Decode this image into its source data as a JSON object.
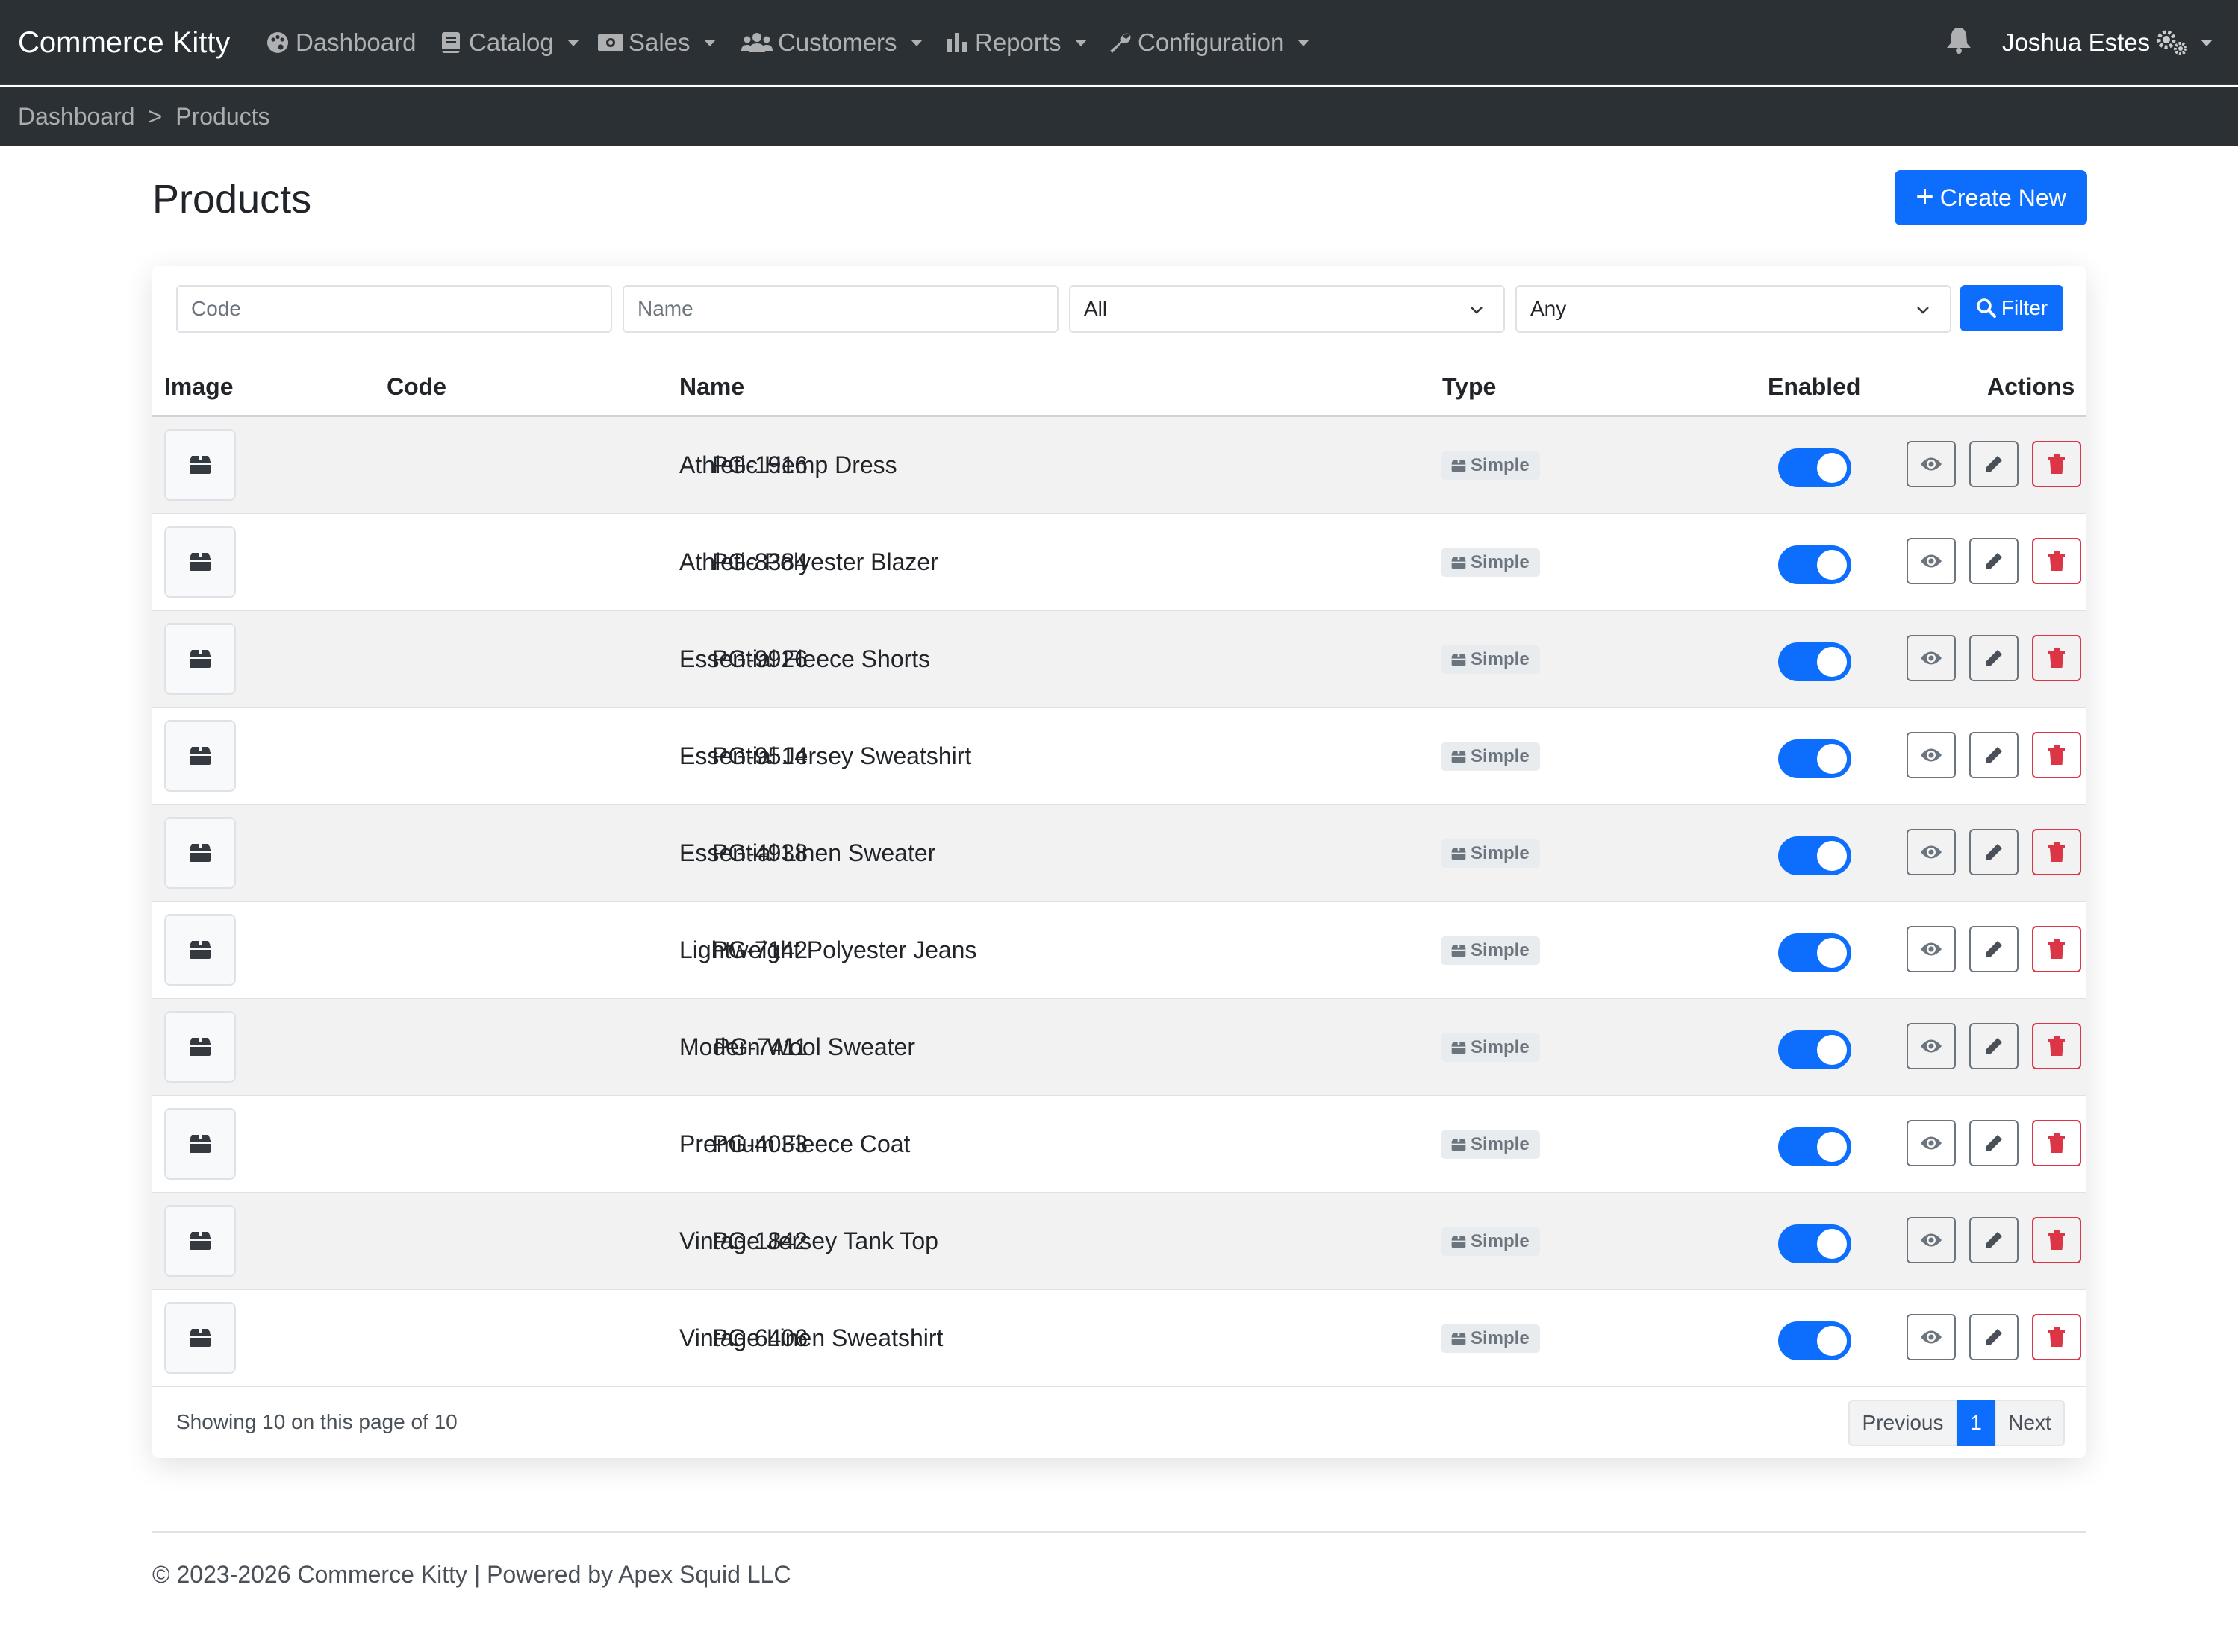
{
  "app": {
    "brand": "Commerce Kitty"
  },
  "nav": {
    "items": [
      {
        "label": "Dashboard",
        "icon": "palette-icon",
        "dropdown": false
      },
      {
        "label": "Catalog",
        "icon": "book-icon",
        "dropdown": true
      },
      {
        "label": "Sales",
        "icon": "money-bill-icon",
        "dropdown": true
      },
      {
        "label": "Customers",
        "icon": "users-icon",
        "dropdown": true
      },
      {
        "label": "Reports",
        "icon": "chart-bar-icon",
        "dropdown": true
      },
      {
        "label": "Configuration",
        "icon": "wrench-icon",
        "dropdown": true
      }
    ],
    "notifications_icon": "bell-icon",
    "user": {
      "name": "Joshua Estes",
      "icon": "gears-icon"
    }
  },
  "breadcrumb": {
    "items": [
      "Dashboard",
      "Products"
    ],
    "separator": ">"
  },
  "page": {
    "title": "Products",
    "create_label": "Create New"
  },
  "filters": {
    "code_placeholder": "Code",
    "name_placeholder": "Name",
    "type_selected": "All",
    "enabled_selected": "Any",
    "filter_label": "Filter"
  },
  "table": {
    "headers": {
      "image": "Image",
      "code": "Code",
      "name": "Name",
      "type": "Type",
      "enabled": "Enabled",
      "actions": "Actions"
    },
    "rows": [
      {
        "code": "PG-1916",
        "name": "Athletic Hemp Dress",
        "type": "Simple",
        "enabled": true
      },
      {
        "code": "PG-8384",
        "name": "Athletic Polyester Blazer",
        "type": "Simple",
        "enabled": true
      },
      {
        "code": "PG-9926",
        "name": "Essential Fleece Shorts",
        "type": "Simple",
        "enabled": true
      },
      {
        "code": "PG-9514",
        "name": "Essential Jersey Sweatshirt",
        "type": "Simple",
        "enabled": true
      },
      {
        "code": "PG-4938",
        "name": "Essential Linen Sweater",
        "type": "Simple",
        "enabled": true
      },
      {
        "code": "PG-7142",
        "name": "Lightweight Polyester Jeans",
        "type": "Simple",
        "enabled": true
      },
      {
        "code": "PG-7411",
        "name": "Modern Wool Sweater",
        "type": "Simple",
        "enabled": true
      },
      {
        "code": "PG-4033",
        "name": "Premium Fleece Coat",
        "type": "Simple",
        "enabled": true
      },
      {
        "code": "PG-1842",
        "name": "Vintage Jersey Tank Top",
        "type": "Simple",
        "enabled": true
      },
      {
        "code": "PG-6406",
        "name": "Vintage Linen Sweatshirt",
        "type": "Simple",
        "enabled": true
      }
    ]
  },
  "pagination": {
    "summary": "Showing 10 on this page of 10",
    "previous": "Previous",
    "current": "1",
    "next": "Next"
  },
  "footer": {
    "text": "© 2023-2026 Commerce Kitty | Powered by Apex Squid LLC"
  },
  "colors": {
    "primary": "#0d6efd",
    "danger": "#dc3545",
    "navbar": "#2b3035",
    "muted": "#6c757d"
  }
}
